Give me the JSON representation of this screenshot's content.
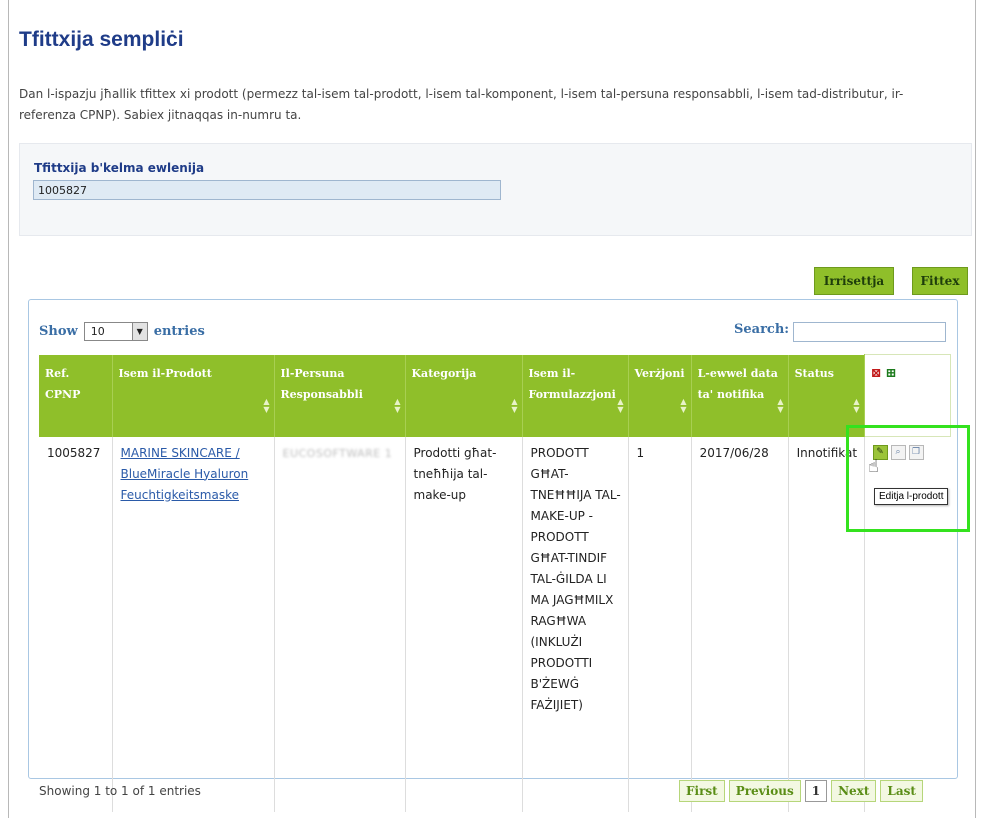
{
  "page": {
    "title": "Tfittxija sempliċi",
    "description": "Dan l-ispazju jħallik tfittex xi prodott (permezz tal-isem tal-prodott, l-isem tal-komponent, l-isem tal-persuna responsabbli, l-isem tad-distributur, ir-referenza CPNP). Sabiex jitnaqqas in-numru ta."
  },
  "search": {
    "label": "Tfittxija b'kelma ewlenija",
    "value": "1005827"
  },
  "buttons": {
    "reset": "Irrisettja",
    "search": "Fittex"
  },
  "table": {
    "show_label": "Show",
    "entries_label": "entries",
    "page_size": "10",
    "search_label": "Search:",
    "headers": [
      "Ref. CPNP",
      "Isem il-Prodott",
      "Il-Persuna Responsabbli",
      "Kategorija",
      "Isem il-Formulazzjoni",
      "Verżjoni",
      "L-ewwel data ta' notifika",
      "Status"
    ],
    "export_icons": [
      "pdf-export-icon",
      "excel-export-icon"
    ],
    "rows": [
      {
        "ref": "1005827",
        "product": "MARINE SKINCARE / BlueMiracle Hyaluron Feuchtigkeitsmaske",
        "responsible": "EUCOSOFTWARE 1",
        "category": "Prodotti għat-tneħħija tal-make-up",
        "formulation": "PRODOTT GĦAT-TNEĦĦIJA TAL-MAKE-UP - PRODOTT GĦAT-TINDIF TAL-ĠILDA LI MA JAGĦMILX RAGĦWA (INKLUŻI PRODOTTI B'ŻEWĠ FAŻIJIET)",
        "version": "1",
        "first_notification": "2017/06/28",
        "status": "Innotifikat"
      }
    ],
    "action_icons": [
      "edit-icon",
      "view-icon",
      "copy-icon"
    ],
    "tooltip": "Editja l-prodott",
    "info": "Showing 1 to 1 of 1 entries",
    "pager": {
      "first": "First",
      "previous": "Previous",
      "current": "1",
      "next": "Next",
      "last": "Last"
    }
  },
  "colors": {
    "accent_green": "#8fbf2a",
    "title_blue": "#1f3c88",
    "highlight": "#34e21e"
  }
}
